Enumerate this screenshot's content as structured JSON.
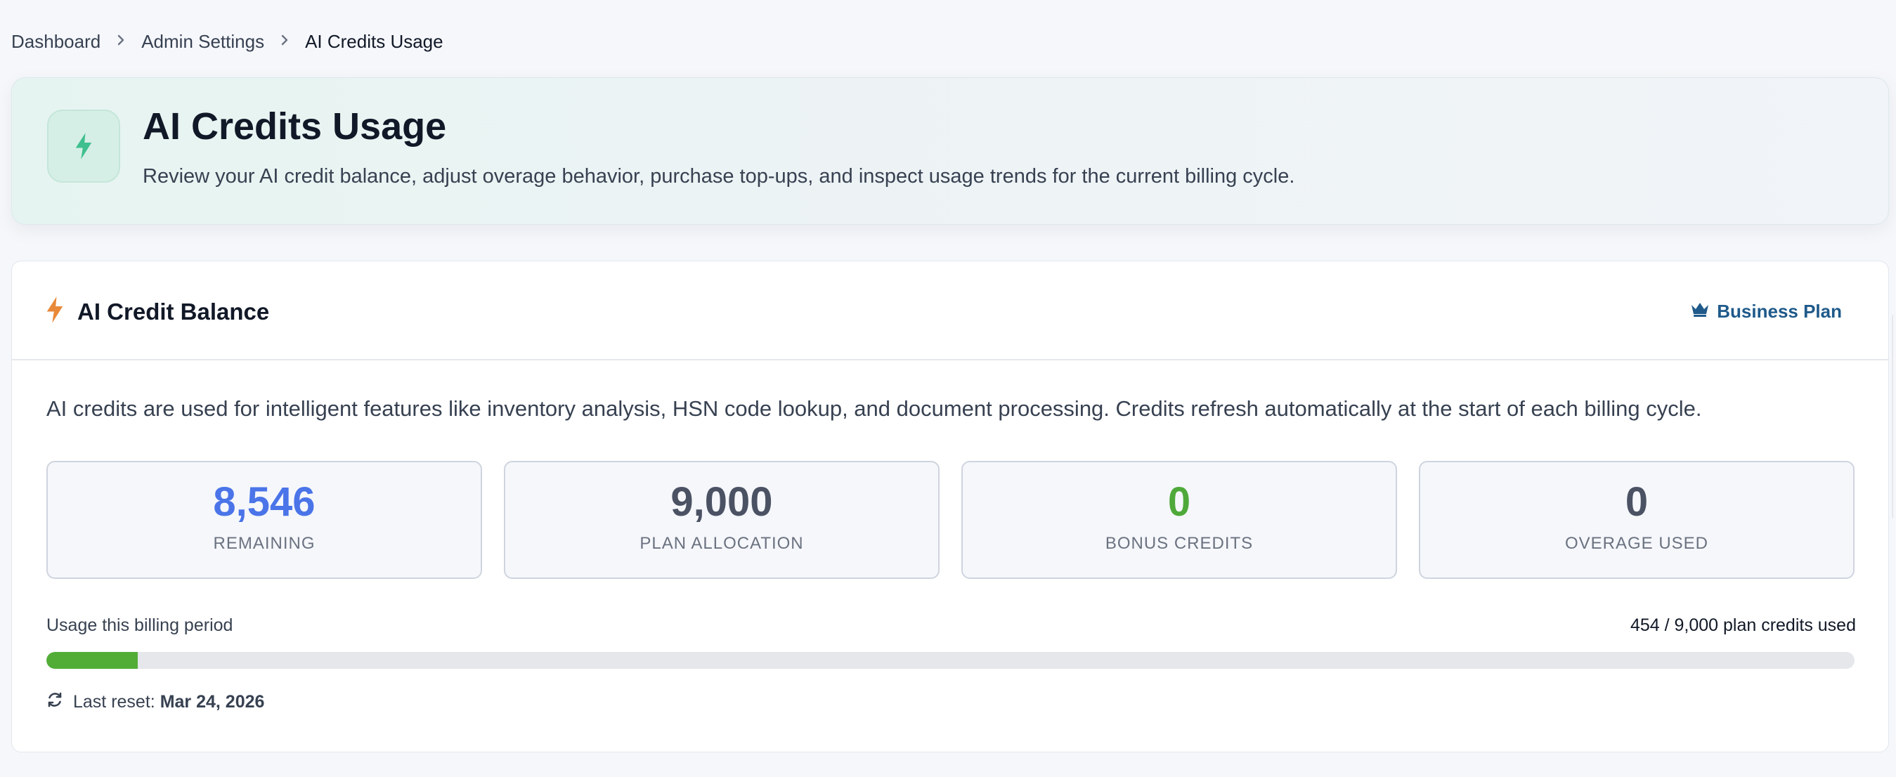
{
  "breadcrumb": {
    "items": [
      "Dashboard",
      "Admin Settings",
      "AI Credits Usage"
    ]
  },
  "hero": {
    "title": "AI Credits Usage",
    "subtitle": "Review your AI credit balance, adjust overage behavior, purchase top-ups, and inspect usage trends for the current billing cycle.",
    "icon": "bolt-icon"
  },
  "balance_card": {
    "title": "AI Credit Balance",
    "plan_label": "Business Plan",
    "plan_icon": "crown-icon",
    "description": "AI credits are used for intelligent features like inventory analysis, HSN code lookup, and document processing. Credits refresh automatically at the start of each billing cycle.",
    "stats": [
      {
        "value": "8,546",
        "label": "REMAINING",
        "color": "#4a74e8"
      },
      {
        "value": "9,000",
        "label": "PLAN ALLOCATION",
        "color": "#4b5263"
      },
      {
        "value": "0",
        "label": "BONUS CREDITS",
        "color": "#4fa93a"
      },
      {
        "value": "0",
        "label": "OVERAGE USED",
        "color": "#4b5263"
      }
    ],
    "usage": {
      "label": "Usage this billing period",
      "count_text": "454 / 9,000 plan credits used",
      "fraction_used": 0.0504
    },
    "reset": {
      "label": "Last reset:",
      "date": "Mar 24, 2026"
    }
  },
  "colors": {
    "accent_green": "#52ad37",
    "bolt_orange": "#e8893a",
    "hero_bolt_green": "#3fbf8f",
    "plan_blue": "#1f5a8a"
  }
}
